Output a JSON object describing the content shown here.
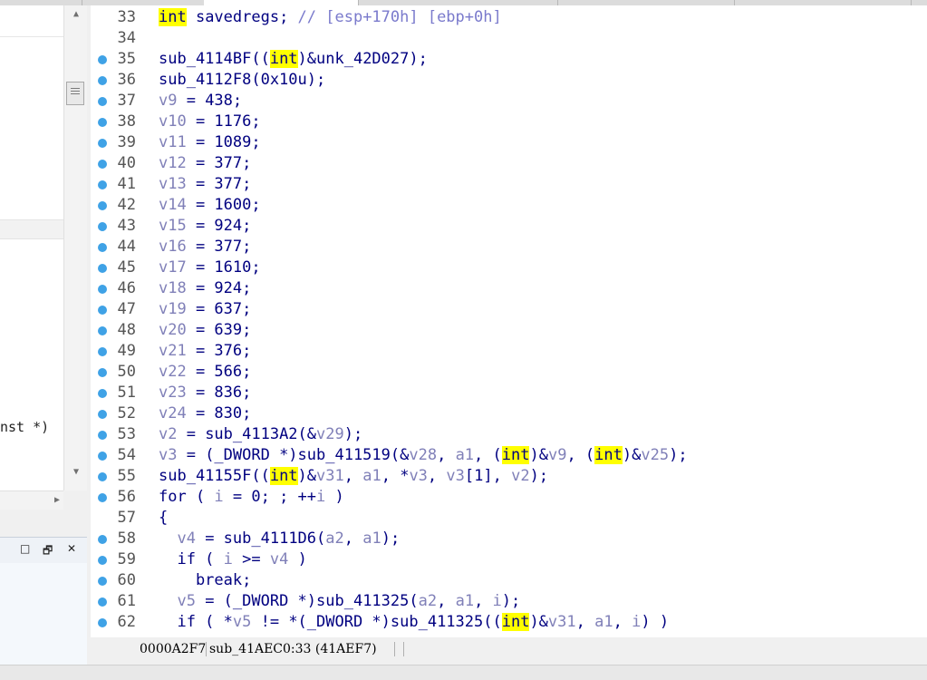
{
  "left_panel": {
    "truncated_text": "nst *)",
    "subwindow_controls": [
      "□",
      "🗗",
      "✕"
    ]
  },
  "code_lines": [
    {
      "num": "33",
      "bp": false,
      "tokens": [
        [
          "kw",
          "int"
        ],
        [
          "p",
          " savedregs; "
        ],
        [
          "cmt",
          "// [esp+170h] [ebp+0h]"
        ]
      ]
    },
    {
      "num": "34",
      "bp": false,
      "tokens": []
    },
    {
      "num": "35",
      "bp": true,
      "tokens": [
        [
          "p",
          "sub_4114BF(("
        ],
        [
          "kw",
          "int"
        ],
        [
          "p",
          ")&unk_42D027);"
        ]
      ]
    },
    {
      "num": "36",
      "bp": true,
      "tokens": [
        [
          "p",
          "sub_4112F8(0x10u);"
        ]
      ]
    },
    {
      "num": "37",
      "bp": true,
      "tokens": [
        [
          "var",
          "v9"
        ],
        [
          "p",
          " = 438;"
        ]
      ]
    },
    {
      "num": "38",
      "bp": true,
      "tokens": [
        [
          "var",
          "v10"
        ],
        [
          "p",
          " = 1176;"
        ]
      ]
    },
    {
      "num": "39",
      "bp": true,
      "tokens": [
        [
          "var",
          "v11"
        ],
        [
          "p",
          " = 1089;"
        ]
      ]
    },
    {
      "num": "40",
      "bp": true,
      "tokens": [
        [
          "var",
          "v12"
        ],
        [
          "p",
          " = 377;"
        ]
      ]
    },
    {
      "num": "41",
      "bp": true,
      "tokens": [
        [
          "var",
          "v13"
        ],
        [
          "p",
          " = 377;"
        ]
      ]
    },
    {
      "num": "42",
      "bp": true,
      "tokens": [
        [
          "var",
          "v14"
        ],
        [
          "p",
          " = 1600;"
        ]
      ]
    },
    {
      "num": "43",
      "bp": true,
      "tokens": [
        [
          "var",
          "v15"
        ],
        [
          "p",
          " = 924;"
        ]
      ]
    },
    {
      "num": "44",
      "bp": true,
      "tokens": [
        [
          "var",
          "v16"
        ],
        [
          "p",
          " = 377;"
        ]
      ]
    },
    {
      "num": "45",
      "bp": true,
      "tokens": [
        [
          "var",
          "v17"
        ],
        [
          "p",
          " = 1610;"
        ]
      ]
    },
    {
      "num": "46",
      "bp": true,
      "tokens": [
        [
          "var",
          "v18"
        ],
        [
          "p",
          " = 924;"
        ]
      ]
    },
    {
      "num": "47",
      "bp": true,
      "tokens": [
        [
          "var",
          "v19"
        ],
        [
          "p",
          " = 637;"
        ]
      ]
    },
    {
      "num": "48",
      "bp": true,
      "tokens": [
        [
          "var",
          "v20"
        ],
        [
          "p",
          " = 639;"
        ]
      ]
    },
    {
      "num": "49",
      "bp": true,
      "tokens": [
        [
          "var",
          "v21"
        ],
        [
          "p",
          " = 376;"
        ]
      ]
    },
    {
      "num": "50",
      "bp": true,
      "tokens": [
        [
          "var",
          "v22"
        ],
        [
          "p",
          " = 566;"
        ]
      ]
    },
    {
      "num": "51",
      "bp": true,
      "tokens": [
        [
          "var",
          "v23"
        ],
        [
          "p",
          " = 836;"
        ]
      ]
    },
    {
      "num": "52",
      "bp": true,
      "tokens": [
        [
          "var",
          "v24"
        ],
        [
          "p",
          " = 830;"
        ]
      ]
    },
    {
      "num": "53",
      "bp": true,
      "tokens": [
        [
          "var",
          "v2"
        ],
        [
          "p",
          " = sub_4113A2(&"
        ],
        [
          "var",
          "v29"
        ],
        [
          "p",
          ");"
        ]
      ]
    },
    {
      "num": "54",
      "bp": true,
      "tokens": [
        [
          "var",
          "v3"
        ],
        [
          "p",
          " = (_DWORD *)sub_411519(&"
        ],
        [
          "var",
          "v28"
        ],
        [
          "p",
          ", "
        ],
        [
          "var",
          "a1"
        ],
        [
          "p",
          ", ("
        ],
        [
          "kw",
          "int"
        ],
        [
          "p",
          ")&"
        ],
        [
          "var",
          "v9"
        ],
        [
          "p",
          ", ("
        ],
        [
          "kw",
          "int"
        ],
        [
          "p",
          ")&"
        ],
        [
          "var",
          "v25"
        ],
        [
          "p",
          ");"
        ]
      ]
    },
    {
      "num": "55",
      "bp": true,
      "tokens": [
        [
          "p",
          "sub_41155F(("
        ],
        [
          "kw",
          "int"
        ],
        [
          "p",
          ")&"
        ],
        [
          "var",
          "v31"
        ],
        [
          "p",
          ", "
        ],
        [
          "var",
          "a1"
        ],
        [
          "p",
          ", *"
        ],
        [
          "var",
          "v3"
        ],
        [
          "p",
          ", "
        ],
        [
          "var",
          "v3"
        ],
        [
          "p",
          "[1], "
        ],
        [
          "var",
          "v2"
        ],
        [
          "p",
          ");"
        ]
      ]
    },
    {
      "num": "56",
      "bp": true,
      "tokens": [
        [
          "p",
          "for ( "
        ],
        [
          "var",
          "i"
        ],
        [
          "p",
          " = 0; ; ++"
        ],
        [
          "var",
          "i"
        ],
        [
          "p",
          " )"
        ]
      ]
    },
    {
      "num": "57",
      "bp": false,
      "tokens": [
        [
          "p",
          "{"
        ]
      ]
    },
    {
      "num": "58",
      "bp": true,
      "tokens": [
        [
          "p",
          "  "
        ],
        [
          "var",
          "v4"
        ],
        [
          "p",
          " = sub_4111D6("
        ],
        [
          "var",
          "a2"
        ],
        [
          "p",
          ", "
        ],
        [
          "var",
          "a1"
        ],
        [
          "p",
          ");"
        ]
      ]
    },
    {
      "num": "59",
      "bp": true,
      "tokens": [
        [
          "p",
          "  if ( "
        ],
        [
          "var",
          "i"
        ],
        [
          "p",
          " >= "
        ],
        [
          "var",
          "v4"
        ],
        [
          "p",
          " )"
        ]
      ]
    },
    {
      "num": "60",
      "bp": true,
      "tokens": [
        [
          "p",
          "    break;"
        ]
      ]
    },
    {
      "num": "61",
      "bp": true,
      "tokens": [
        [
          "p",
          "  "
        ],
        [
          "var",
          "v5"
        ],
        [
          "p",
          " = (_DWORD *)sub_411325("
        ],
        [
          "var",
          "a2"
        ],
        [
          "p",
          ", "
        ],
        [
          "var",
          "a1"
        ],
        [
          "p",
          ", "
        ],
        [
          "var",
          "i"
        ],
        [
          "p",
          ");"
        ]
      ]
    },
    {
      "num": "62",
      "bp": true,
      "tokens": [
        [
          "p",
          "  if ( *"
        ],
        [
          "var",
          "v5"
        ],
        [
          "p",
          " != *(_DWORD *)sub_411325(("
        ],
        [
          "kw",
          "int"
        ],
        [
          "p",
          ")&"
        ],
        [
          "var",
          "v31"
        ],
        [
          "p",
          ", "
        ],
        [
          "var",
          "a1"
        ],
        [
          "p",
          ", "
        ],
        [
          "var",
          "i"
        ],
        [
          "p",
          ") )"
        ]
      ]
    }
  ],
  "status_bar": {
    "address": "0000A2F7",
    "location": "sub_41AEC0:33 (41AEF7)"
  }
}
